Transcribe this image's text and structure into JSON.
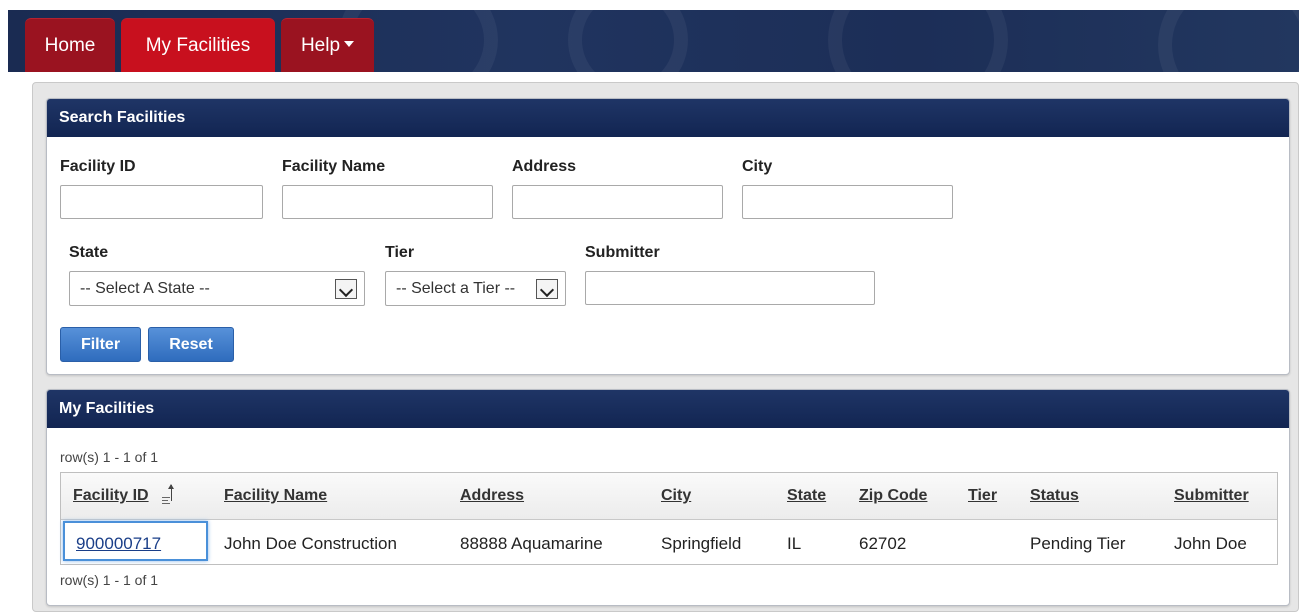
{
  "nav": {
    "tabs": [
      {
        "label": "Home"
      },
      {
        "label": "My Facilities"
      },
      {
        "label": "Help"
      }
    ]
  },
  "search": {
    "title": "Search Facilities",
    "facility_id_label": "Facility ID",
    "facility_id_value": "",
    "facility_name_label": "Facility Name",
    "facility_name_value": "",
    "address_label": "Address",
    "address_value": "",
    "city_label": "City",
    "city_value": "",
    "state_label": "State",
    "state_selected": "-- Select A State --",
    "tier_label": "Tier",
    "tier_selected": "-- Select a Tier --",
    "submitter_label": "Submitter",
    "submitter_value": "",
    "filter_label": "Filter",
    "reset_label": "Reset"
  },
  "facilities": {
    "title": "My Facilities",
    "row_info_top": "row(s) 1 - 1 of 1",
    "row_info_bottom": "row(s) 1 - 1 of 1",
    "columns": [
      "Facility ID",
      "Facility Name",
      "Address",
      "City",
      "State",
      "Zip Code",
      "Tier",
      "Status",
      "Submitter"
    ],
    "rows": [
      [
        "900000717",
        "John Doe Construction",
        "88888 Aquamarine",
        "Springfield",
        "IL",
        "62702",
        "",
        "Pending Tier",
        "John Doe"
      ]
    ]
  },
  "colors": {
    "nav_tab": "#9a1320",
    "nav_tab_active": "#c8101e",
    "panel_header": "#1a2d5c",
    "button": "#3b78c8",
    "link": "#1a3e88"
  }
}
